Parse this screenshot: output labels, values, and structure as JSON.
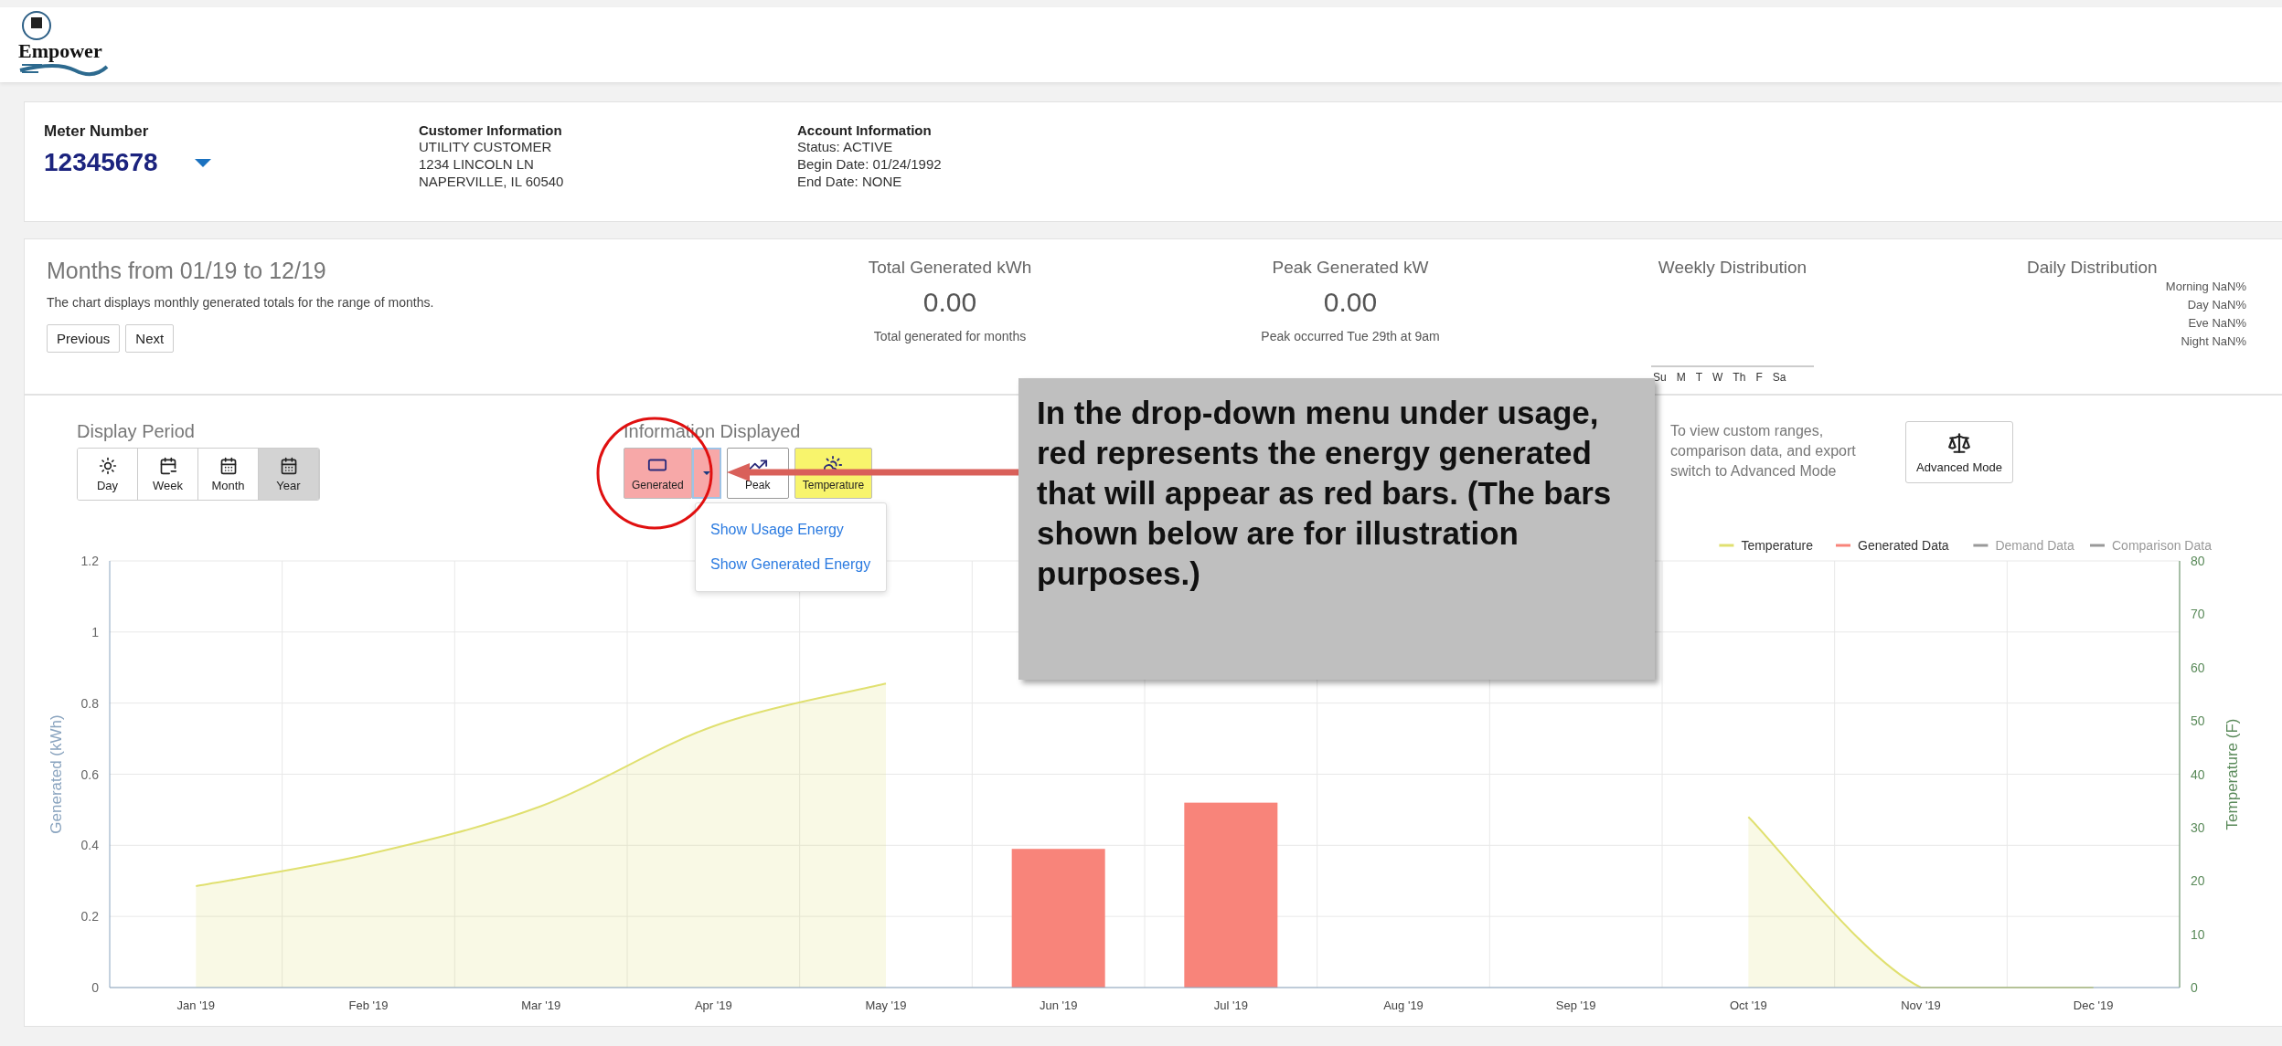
{
  "header": {
    "logo_text": "Empower"
  },
  "meter": {
    "label": "Meter Number",
    "number": "12345678"
  },
  "customer": {
    "title": "Customer Information",
    "lines": [
      "UTILITY CUSTOMER",
      "1234 LINCOLN LN",
      "NAPERVILLE, IL 60540"
    ]
  },
  "account": {
    "title": "Account Information",
    "lines": [
      "Status: ACTIVE",
      "Begin Date: 01/24/1992",
      "End Date: NONE"
    ]
  },
  "summary": {
    "title": "Months from 01/19 to 12/19",
    "description": "The chart displays monthly generated totals for the range of months.",
    "nav_buttons": [
      "Previous",
      "Next"
    ],
    "stats": [
      {
        "title": "Total Generated kWh",
        "value": "0.00",
        "note": "Total generated for months"
      },
      {
        "title": "Peak Generated kW",
        "value": "0.00",
        "note": "Peak occurred Tue 29th at 9am"
      }
    ],
    "weekly": {
      "title": "Weekly Distribution",
      "days": [
        "Su",
        "M",
        "T",
        "W",
        "Th",
        "F",
        "Sa"
      ]
    },
    "daily": {
      "title": "Daily Distribution",
      "items": [
        "Morning NaN%",
        "Day NaN%",
        "Eve NaN%",
        "Night NaN%"
      ]
    }
  },
  "display_period": {
    "label": "Display Period",
    "options": [
      {
        "label": "Day",
        "selected": false
      },
      {
        "label": "Week",
        "selected": false
      },
      {
        "label": "Month",
        "selected": false
      },
      {
        "label": "Year",
        "selected": true
      }
    ]
  },
  "information": {
    "label": "Information Displayed",
    "buttons": [
      {
        "label": "Generated",
        "on": true,
        "color": "#f7a8a8",
        "dropdown": true
      },
      {
        "label": "Peak",
        "on": false,
        "color": "#ffffff",
        "dropdown": false
      },
      {
        "label": "Temperature",
        "on": true,
        "color": "#f8f46c",
        "dropdown": false
      }
    ],
    "menu": [
      "Show Usage Energy",
      "Show Generated Energy"
    ]
  },
  "advanced": {
    "text": "To view custom ranges, comparison data, and export switch to Advanced Mode",
    "button": "Advanced Mode"
  },
  "chart_data": {
    "type": "bar",
    "ylabel": "Generated (kWh)",
    "y2label": "Temperature (F)",
    "categories": [
      "Jan '19",
      "Feb '19",
      "Mar '19",
      "Apr '19",
      "May '19",
      "Jun '19",
      "Jul '19",
      "Aug '19",
      "Sep '19",
      "Oct '19",
      "Nov '19",
      "Dec '19"
    ],
    "series": [
      {
        "name": "Temperature",
        "type": "area",
        "axis": "y2",
        "color": "#e0e070",
        "values": [
          19,
          25,
          34,
          49,
          57,
          null,
          null,
          null,
          null,
          32,
          0,
          0
        ]
      },
      {
        "name": "Generated Data",
        "color": "#f8847a",
        "values": [
          0,
          0,
          0,
          0,
          0,
          0.39,
          0.52,
          0,
          0,
          0,
          0,
          0
        ]
      }
    ],
    "grid": true,
    "legend": "upper right",
    "ylim": [
      0,
      1.2
    ],
    "yticks": [
      0,
      0.2,
      0.4,
      0.6,
      0.8,
      1,
      1.2
    ],
    "y2lim": [
      0,
      80
    ],
    "y2ticks": [
      0,
      10,
      20,
      30,
      40,
      50,
      60,
      70,
      80
    ]
  },
  "inactive_legend": [
    "Demand Data",
    "Comparison Data"
  ],
  "callout": {
    "text": "In the drop-down menu under usage, red represents the energy generated that will appear as red bars. (The bars shown below are for illustration purposes.)"
  }
}
